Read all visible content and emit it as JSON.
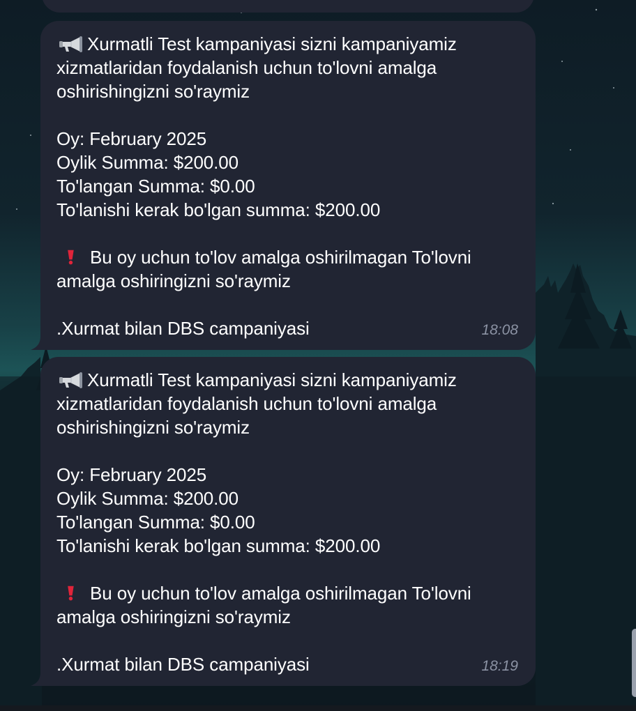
{
  "chat": {
    "messages": [
      {
        "header_line1": "Xurmatli Test kampaniyasi sizni kampaniyamiz",
        "header_line2": "xizmatlaridan foydalanish uchun to'lovni amalga",
        "header_line3": "oshirishingizni so'raymiz",
        "month_line": "Oy: February 2025",
        "monthly_sum_line": "Oylik Summa: $200.00",
        "paid_sum_line": "To'langan Summa: $0.00",
        "due_sum_line": "To'lanishi kerak bo'lgan summa: $200.00",
        "warning_line1": "Bu oy uchun to'lov amalga oshirilmagan To'lovni",
        "warning_line2": "amalga oshiringizni so'raymiz",
        "signature": ".Xurmat bilan DBS campaniyasi",
        "time": "18:08"
      },
      {
        "header_line1": "Xurmatli Test kampaniyasi sizni kampaniyamiz",
        "header_line2": "xizmatlaridan foydalanish uchun to'lovni amalga",
        "header_line3": "oshirishingizni so'raymiz",
        "month_line": "Oy: February 2025",
        "monthly_sum_line": "Oylik Summa: $200.00",
        "paid_sum_line": "To'langan Summa: $0.00",
        "due_sum_line": "To'lanishi kerak bo'lgan summa: $200.00",
        "warning_line1": "Bu oy uchun to'lov amalga oshirilmagan To'lovni",
        "warning_line2": "amalga oshiringizni so'raymiz",
        "signature": ".Xurmat bilan DBS campaniyasi",
        "time": "18:19"
      }
    ]
  },
  "icons": {
    "announcement": "megaphone-icon",
    "warning": "red-exclamation-icon"
  },
  "colors": {
    "bubble_bg": "#212533",
    "text": "#ffffff",
    "time": "#8c93a4",
    "warning": "#e0243a",
    "sky_top": "#0d1b24",
    "glow": "#1d5a5c",
    "trees": "#0f1f26"
  }
}
